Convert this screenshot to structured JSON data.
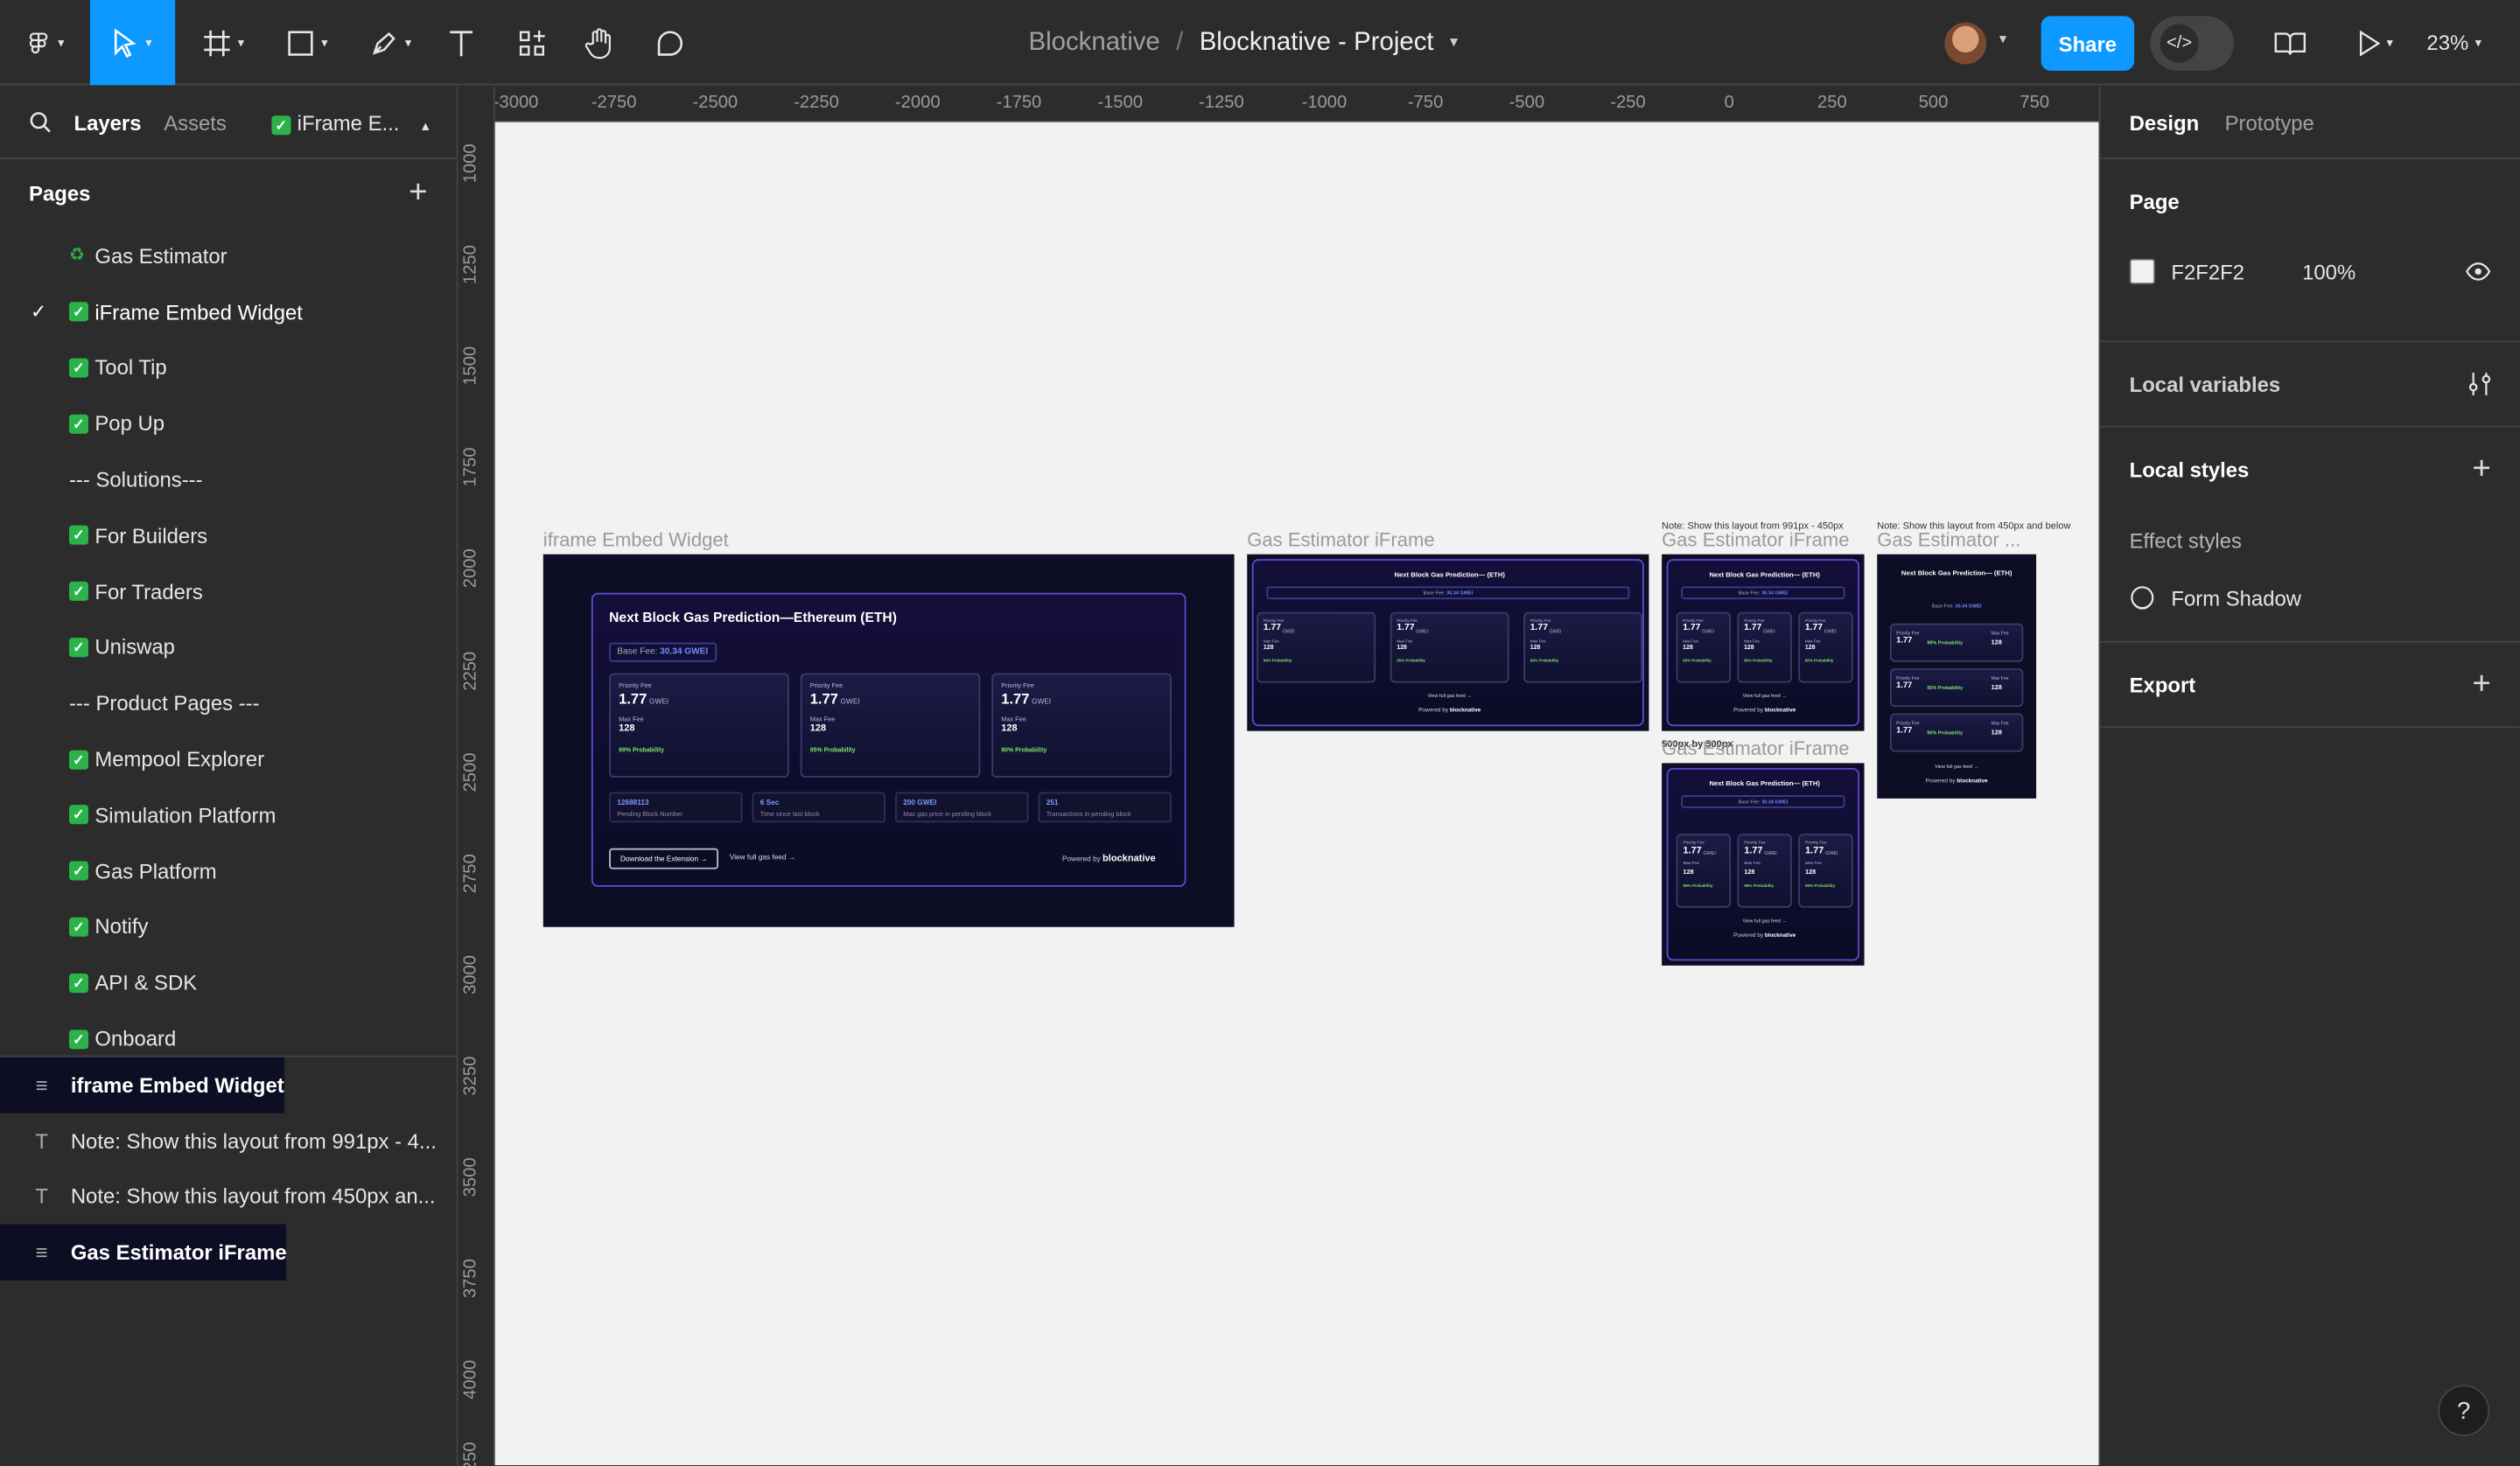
{
  "toolbar": {
    "team": "Blocknative",
    "separator": "/",
    "project": "Blocknative - Project",
    "share_label": "Share",
    "devmode_label": "</>",
    "zoom": "23%"
  },
  "left_panel": {
    "tab_layers": "Layers",
    "tab_assets": "Assets",
    "current_page_short": "iFrame E...",
    "pages_heading": "Pages",
    "pages": [
      {
        "label": "Gas Estimator",
        "icon": "recycle"
      },
      {
        "label": "iFrame Embed Widget",
        "icon": "check",
        "current": true
      },
      {
        "label": "Tool Tip",
        "icon": "check"
      },
      {
        "label": "Pop Up",
        "icon": "check"
      },
      {
        "label": "--- Solutions---",
        "icon": ""
      },
      {
        "label": "For Builders",
        "icon": "check"
      },
      {
        "label": "For Traders",
        "icon": "check"
      },
      {
        "label": "Uniswap",
        "icon": "check"
      },
      {
        "label": "--- Product Pages ---",
        "icon": ""
      },
      {
        "label": "Mempool Explorer",
        "icon": "check"
      },
      {
        "label": "Simulation Platform",
        "icon": "check"
      },
      {
        "label": "Gas Platform",
        "icon": "check"
      },
      {
        "label": "Notify",
        "icon": "check"
      },
      {
        "label": "API & SDK",
        "icon": "check"
      },
      {
        "label": "Onboard",
        "icon": "check"
      }
    ],
    "layers": [
      {
        "label": "iframe Embed Widget",
        "type": "frame"
      },
      {
        "label": "500px by 500px",
        "type": "text"
      },
      {
        "label": "Note: Show this layout from 991px - 4...",
        "type": "text"
      },
      {
        "label": "Note: Show this layout from 450px an...",
        "type": "text"
      },
      {
        "label": "Gas Estimator iFrame",
        "type": "frame"
      },
      {
        "label": "Gas Estimator iFrame",
        "type": "frame"
      },
      {
        "label": "Gas Estimator iFrame",
        "type": "frame"
      }
    ]
  },
  "rulers": {
    "top": [
      "-3000",
      "-2750",
      "-2500",
      "-2250",
      "-2000",
      "-1750",
      "-1500",
      "-1250",
      "-1000",
      "-750",
      "-500",
      "-250",
      "0",
      "250",
      "500",
      "750"
    ],
    "left": [
      "1000",
      "1250",
      "1500",
      "1750",
      "2000",
      "2250",
      "2500",
      "2750",
      "3000",
      "3250",
      "3500",
      "3750",
      "4000",
      "4250"
    ]
  },
  "canvas": {
    "frame_labels": {
      "embed": "iframe Embed Widget",
      "gas1": "Gas Estimator iFrame",
      "gas2": "Gas Estimator iFrame",
      "gas3": "Gas Estimator ...",
      "gas4": "Gas Estimator iFrame"
    },
    "notes": {
      "note1": "Note: Show this layout from 991px - 450px",
      "note2": "Note: Show this layout from 450px and below",
      "size": "500px by 500px"
    },
    "widget": {
      "title_full": "Next Block Gas Prediction—Ethereum (ETH)",
      "title_short": "Next Block Gas Prediction— (ETH)",
      "base_fee_label": "Base Fee:",
      "base_fee_value": "30.34 GWEI",
      "priority_label": "Priority Fee",
      "priority_value": "1.77",
      "unit": "GWEI",
      "max_fee_label": "Max Fee",
      "max_fee_value": "128",
      "probs": [
        "99% Probability",
        "95% Probability",
        "90% Probability"
      ],
      "stats": [
        {
          "value": "12688113",
          "label": "Pending Block Number"
        },
        {
          "value": "6 Sec",
          "label": "Time since last block"
        },
        {
          "value": "200 GWEI",
          "label": "Max gas price in pending block"
        },
        {
          "value": "251",
          "label": "Transactions in pending block"
        }
      ],
      "download_label": "Download the Extension  →",
      "view_feed": "View full gas feed  →",
      "powered_by": "Powered by",
      "brand": "blocknative"
    }
  },
  "right_panel": {
    "tab_design": "Design",
    "tab_prototype": "Prototype",
    "page_heading": "Page",
    "page_color": "F2F2F2",
    "page_opacity": "100%",
    "local_variables": "Local variables",
    "local_styles": "Local styles",
    "effect_styles": "Effect styles",
    "form_shadow": "Form Shadow",
    "export": "Export"
  },
  "help": "?"
}
